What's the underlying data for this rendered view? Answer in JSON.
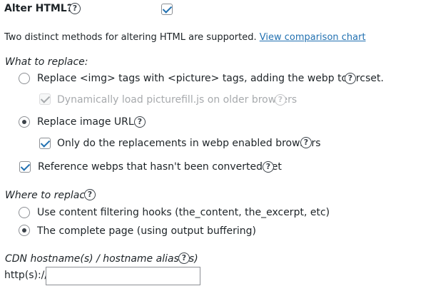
{
  "alter_html": {
    "label": "Alter HTML?",
    "help": "?",
    "checked": true
  },
  "intro": {
    "text": "Two distinct methods for altering HTML are supported.",
    "link": "View comparison chart"
  },
  "what_to_replace": {
    "heading": "What to replace:",
    "options": [
      {
        "label": "Replace <img> tags with <picture> tags, adding the webp to srcset.",
        "selected": false,
        "help": "?"
      },
      {
        "label": "Replace image URLs",
        "selected": true,
        "help": "?"
      }
    ],
    "picturefill": {
      "label": "Dynamically load picturefill.js on older browsers",
      "checked": true,
      "disabled": true,
      "help": "?"
    },
    "only_webp": {
      "label": "Only do the replacements in webp enabled browsers",
      "checked": true,
      "help": "?"
    },
    "reference_unconverted": {
      "label": "Reference webps that hasn't been converted yet",
      "checked": true,
      "help": "?"
    }
  },
  "where_to_replace": {
    "heading": "Where to replace:",
    "help": "?",
    "options": [
      {
        "label": "Use content filtering hooks (the_content, the_excerpt, etc)",
        "selected": false
      },
      {
        "label": "The complete page (using output buffering)",
        "selected": true
      }
    ]
  },
  "cdn": {
    "heading": "CDN hostname(s) / hostname alias(es)",
    "help": "?",
    "prefix": "http(s)://",
    "value": ""
  }
}
